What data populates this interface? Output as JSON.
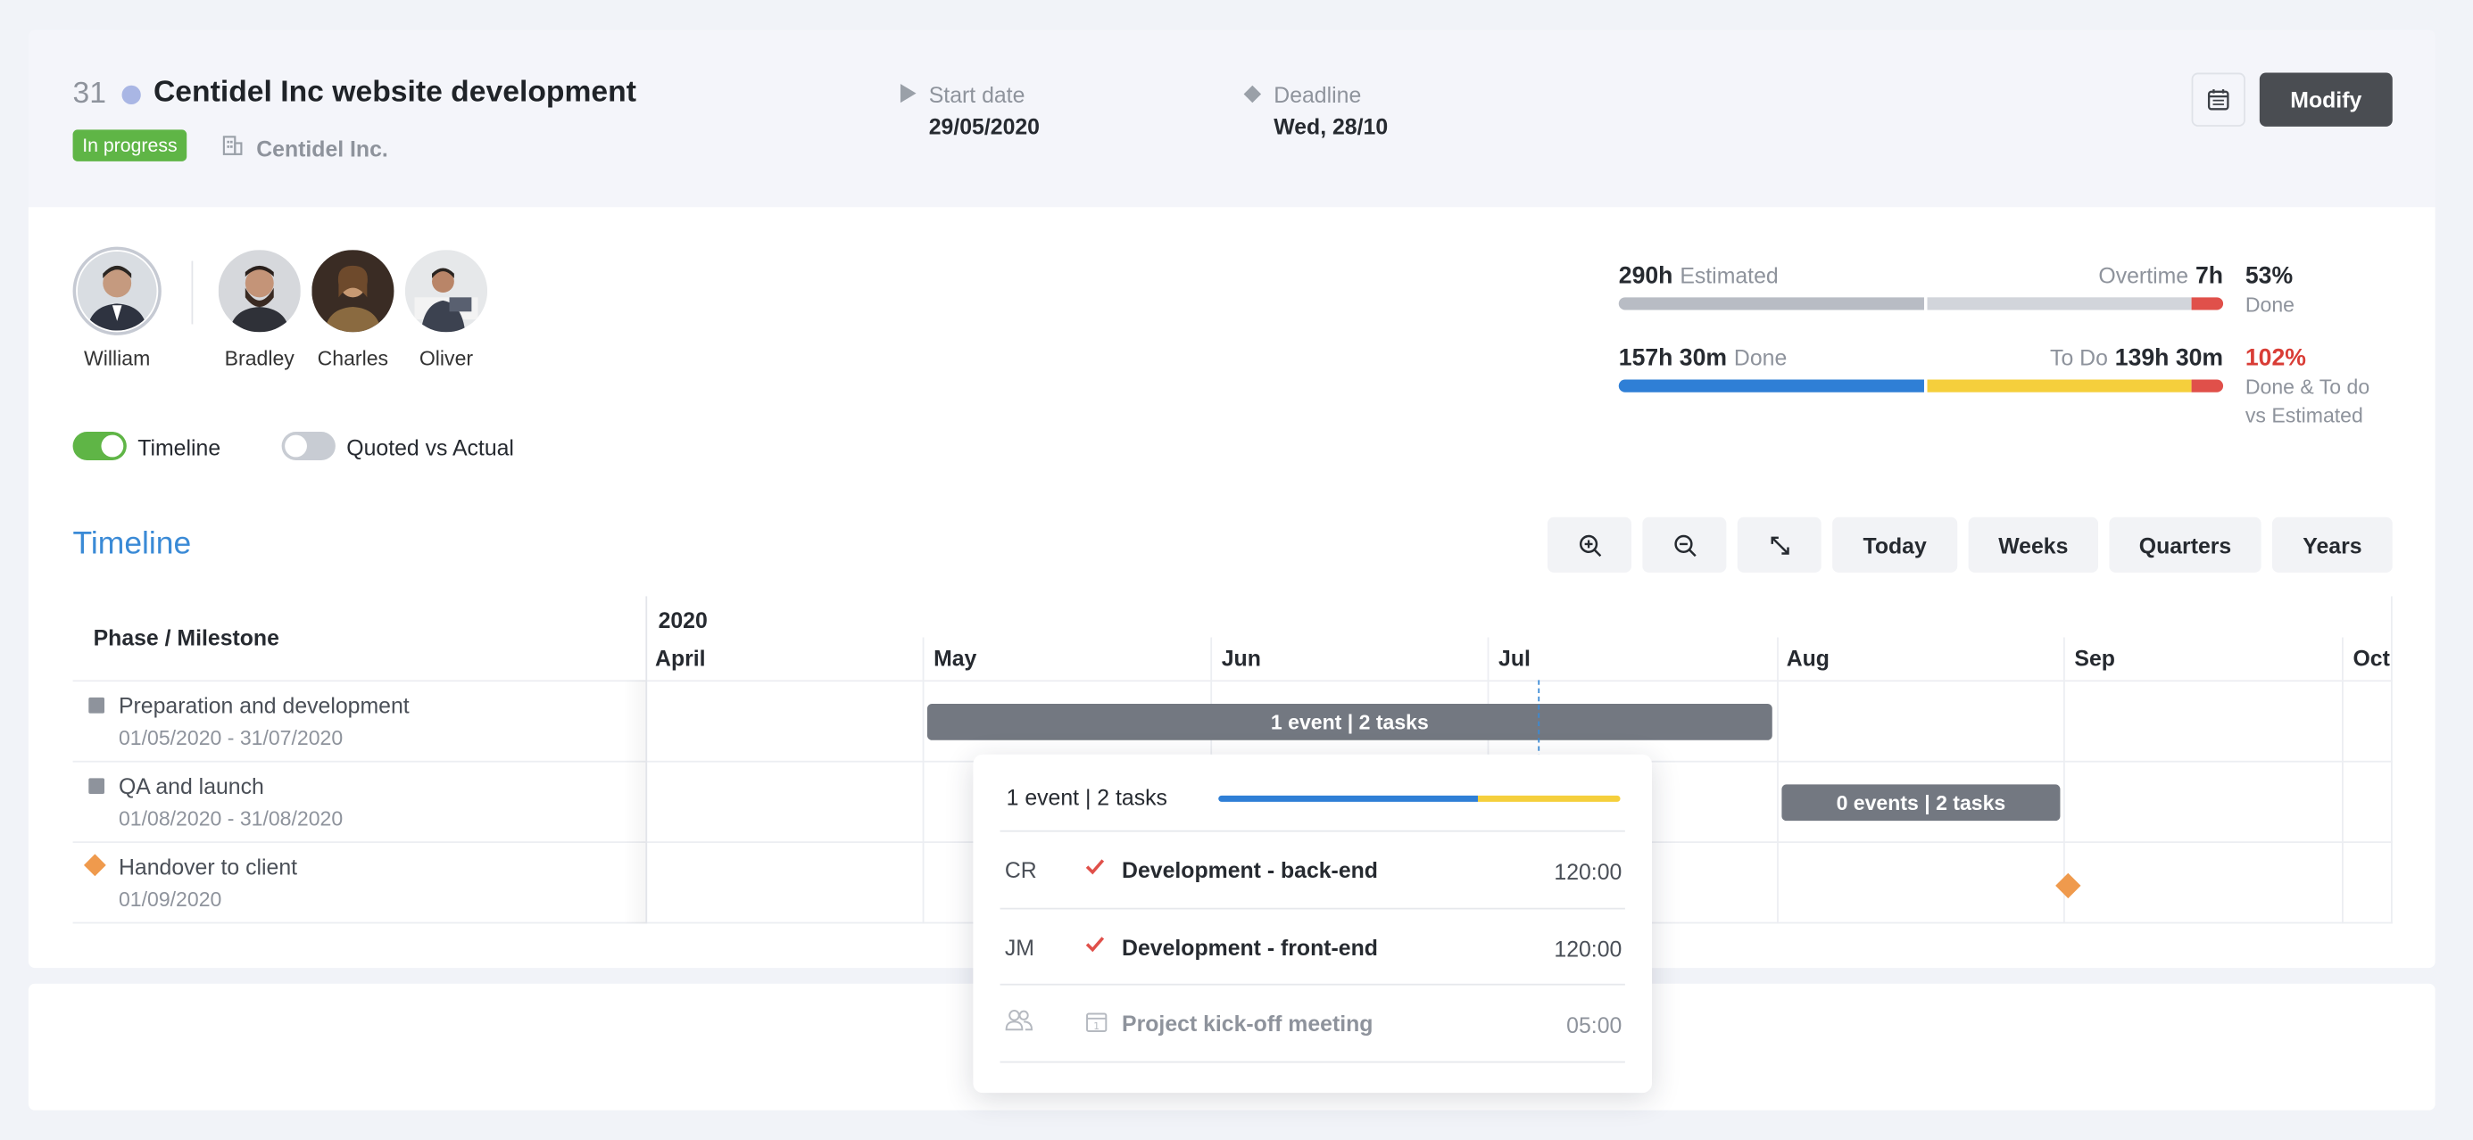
{
  "project": {
    "id": "31",
    "title": "Centidel Inc website development",
    "status": "In progress",
    "client": "Centidel Inc.",
    "start_label": "Start date",
    "start_value": "29/05/2020",
    "deadline_label": "Deadline",
    "deadline_value": "Wed, 28/10",
    "modify_label": "Modify"
  },
  "team": {
    "owner": "William",
    "members": [
      "Bradley",
      "Charles",
      "Oliver"
    ]
  },
  "toggles": {
    "timeline_label": "Timeline",
    "timeline_on": true,
    "quoted_label": "Quoted vs Actual",
    "quoted_on": false
  },
  "stats": {
    "estimated_value": "290h",
    "estimated_label": "Estimated",
    "overtime_label": "Overtime",
    "overtime_value": "7h",
    "done_pct": "53%",
    "done_pct_label": "Done",
    "done_value": "157h 30m",
    "done_label": "Done",
    "todo_label": "To Do",
    "todo_value": "139h 30m",
    "total_pct": "102%",
    "total_pct_label_1": "Done & To do",
    "total_pct_label_2": "vs Estimated",
    "estimated_bar_progress": 0.53,
    "done_bar_progress": 0.53,
    "todo_bar_progress": 0.47,
    "overtime_bar_progress": 0.02
  },
  "timeline": {
    "title": "Timeline",
    "buttons": [
      "Today",
      "Weeks",
      "Quarters",
      "Years"
    ],
    "column_header": "Phase / Milestone",
    "year": "2020",
    "months": [
      "April",
      "May",
      "Jun",
      "Jul",
      "Aug",
      "Sep",
      "Oct"
    ],
    "phases": [
      {
        "name": "Preparation and development",
        "dates": "01/05/2020 - 31/07/2020",
        "bar": "1 event | 2 tasks"
      },
      {
        "name": "QA and launch",
        "dates": "01/08/2020 - 31/08/2020",
        "bar": "0 events | 2 tasks"
      },
      {
        "name": "Handover to client",
        "dates": "01/09/2020",
        "bar": ""
      }
    ]
  },
  "popup": {
    "summary": "1 event | 2 tasks",
    "done_fraction": 0.65,
    "rows": [
      {
        "initials": "CR",
        "task": "Development - back-end",
        "time": "120:00"
      },
      {
        "initials": "JM",
        "task": "Development - front-end",
        "time": "120:00"
      },
      {
        "initials": "",
        "task": "Project kick-off meeting",
        "time": "05:00"
      }
    ]
  },
  "colors": {
    "accent": "#3a8ad6",
    "status_green": "#5fb546",
    "done_blue": "#2f7fd6",
    "todo_yellow": "#f5cf3c",
    "overtime_red": "#e0504a",
    "milestone_orange": "#ef9a4d"
  }
}
